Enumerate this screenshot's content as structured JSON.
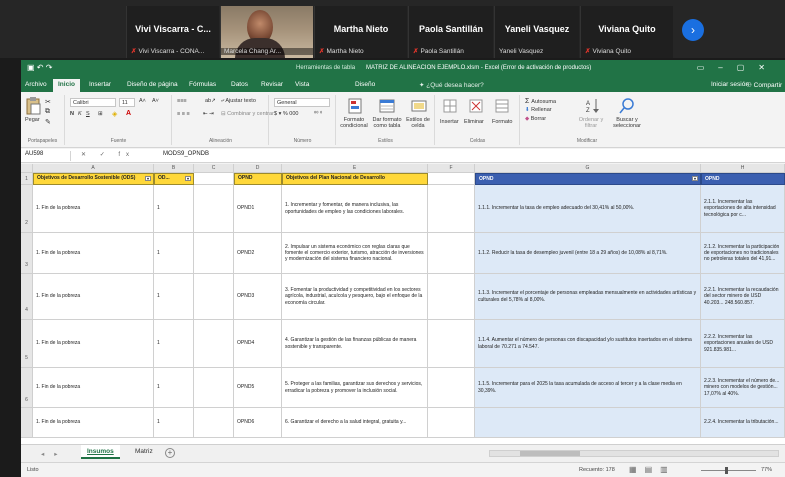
{
  "videocall": {
    "tiles": [
      {
        "name": "Vivi Viscarra - C...",
        "subtitle": "Vivi Viscarra - CONA..."
      },
      {
        "name": "",
        "subtitle": "Marcela Chang Ar..."
      },
      {
        "name": "Martha Nieto",
        "subtitle": "Martha Nieto"
      },
      {
        "name": "Paola Santillán",
        "subtitle": "Paola Santillán"
      },
      {
        "name": "Yaneli Vasquez",
        "subtitle": "Yaneli Vasquez"
      },
      {
        "name": "Viviana Quito",
        "subtitle": "Viviana Quito"
      }
    ],
    "next_label": "›"
  },
  "excel": {
    "titlebar": {
      "context_group": "Herramientas de tabla",
      "window_title": "MATRIZ DE ALINEACION EJEMPLO.xlsm - Excel (Error de activación de productos)"
    },
    "tabs": [
      "Archivo",
      "Inicio",
      "Insertar",
      "Diseño de página",
      "Fórmulas",
      "Datos",
      "Revisar",
      "Vista",
      "Diseño"
    ],
    "tell_me": "¿Qué desea hacer?",
    "sign_in": "Iniciar sesión",
    "share": "Compartir",
    "ribbon": {
      "paste": "Pegar",
      "clipboard": "Portapapeles",
      "font_name": "Calibri",
      "font_size": "11",
      "font_group": "Fuente",
      "wrap_text": "Ajustar texto",
      "merge_center": "Combinar y centrar",
      "alignment_group": "Alineación",
      "number_format": "General",
      "number_group": "Número",
      "conditional_format": "Formato condicional",
      "format_as_table": "Dar formato como tabla",
      "cell_styles": "Estilos de celda",
      "styles_group": "Estilos",
      "insert": "Insertar",
      "delete": "Eliminar",
      "format": "Formato",
      "cells_group": "Celdas",
      "autosum": "Autosuma",
      "fill": "Rellenar",
      "clear": "Borrar",
      "sort_filter": "Ordenar y filtrar",
      "find_select": "Buscar y seleccionar",
      "editing_group": "Modificar"
    },
    "formula": {
      "namebox": "AU598",
      "fx_icons": "✕ ✓ fx",
      "content": "MODS9_OPNDB"
    },
    "columns": [
      {
        "letter": "A"
      },
      {
        "letter": "B"
      },
      {
        "letter": "C"
      },
      {
        "letter": "D"
      },
      {
        "letter": "E"
      },
      {
        "letter": "F"
      },
      {
        "letter": "G"
      },
      {
        "letter": "H"
      }
    ],
    "row_numbers": [
      "1",
      "2",
      "3",
      "4",
      "5",
      "6"
    ],
    "headers": {
      "ods": "Objetivos de Desarrollo Sostenible (ODS)",
      "ods_code": "OD...",
      "opnd": "OPND",
      "opnd_desc": "Objetivos del Plan Nacional de Desarrollo",
      "opnd_meta": "OPND",
      "meta2": "OPND"
    },
    "rows": [
      {
        "ods": "1. Fin de la pobreza",
        "code": "1",
        "opnd": "OPND1",
        "desc": "1. Incrementar y fomentar, de manera inclusiva, las oportunidades de empleo y las condiciones laborales.",
        "meta": "1.1.1. Incrementar la tasa de empleo adecuado del 30,41% al 50,00%.",
        "meta2": "2.1.1. Incrementar las exportaciones de alta intensidad tecnológica por c..."
      },
      {
        "ods": "1. Fin de la pobreza",
        "code": "1",
        "opnd": "OPND2",
        "desc": "2. Impulsar un sistema económico con reglas claras que fomente el comercio exterior, turismo, atracción de inversiones y modernización del sistema financiero nacional.",
        "meta": "1.1.2. Reducir la tasa de desempleo juvenil (entre 18 a 29 años) de 10,08% al 8,71%.",
        "meta2": "2.1.2. Incrementar la participación de exportaciones no tradicionales no petroleras totales del 41,91..."
      },
      {
        "ods": "1. Fin de la pobreza",
        "code": "1",
        "opnd": "OPND3",
        "desc": "3. Fomentar la productividad y competitividad en los sectores agrícola, industrial, acuícola y pesquero, bajo el enfoque de la economía circular.",
        "meta": "1.1.3. Incrementar el porcentaje de personas empleadas mensualmente en actividades artísticas y culturales del 5,78% al 8,00%.",
        "meta2": "2.2.1. Incrementar la recaudación del sector minero de USD 40.203... 248.560.857."
      },
      {
        "ods": "1. Fin de la pobreza",
        "code": "1",
        "opnd": "OPND4",
        "desc": "4. Garantizar la gestión de las finanzas públicas de manera sostenible y transparente.",
        "meta": "1.1.4. Aumentar el número de personas con discapacidad y/o sustitutos insertados en el sistema laboral de 70.271 a 74.547.",
        "meta2": "2.2.2. Incrementar las exportaciones anuales de USD 921.835.981..."
      },
      {
        "ods": "1. Fin de la pobreza",
        "code": "1",
        "opnd": "OPND5",
        "desc": "5. Proteger a las familias, garantizar sus derechos y servicios, erradicar la pobreza y promover la inclusión social.",
        "meta": "1.1.5. Incrementar para el 2025 la tasa acumulada de acceso al tercer y a la clase media en 30,39%.",
        "meta2": "2.2.3. Incrementar el número de... minero con modelos de gestión... 17,07% al 40%."
      },
      {
        "ods": "1. Fin de la pobreza",
        "code": "1",
        "opnd": "OPND6",
        "desc": "6. Garantizar el derecho a la salud integral, gratuita y...",
        "meta": "",
        "meta2": "2.2.4. Incrementar la tributación..."
      }
    ],
    "sheets": [
      "Insumos",
      "Matriz"
    ],
    "status": {
      "ready": "Listo",
      "count": "Recuento: 178",
      "zoom": "77%"
    }
  }
}
